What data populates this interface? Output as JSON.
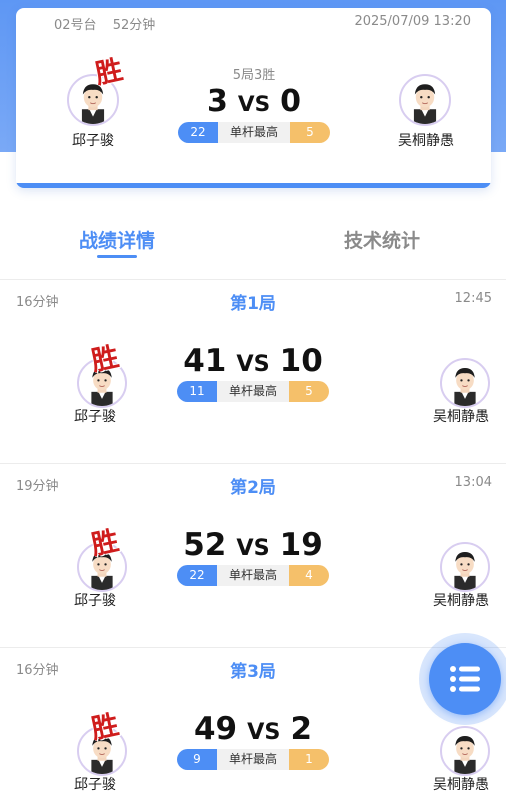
{
  "match": {
    "table": "02号台",
    "duration": "52分钟",
    "datetime": "2025/07/09 13:20",
    "format": "5局3胜",
    "player_a": {
      "name": "邱子骏",
      "score": "3",
      "high_break": "22"
    },
    "player_b": {
      "name": "吴桐静愚",
      "score": "0",
      "high_break": "5"
    },
    "vs": "VS",
    "high_break_label": "单杆最高",
    "win_badge": "胜"
  },
  "tabs": [
    {
      "label": "战绩详情",
      "active": true
    },
    {
      "label": "技术统计",
      "active": false
    }
  ],
  "games": [
    {
      "title": "第1局",
      "duration": "16分钟",
      "time": "12:45",
      "score_a": "41",
      "score_b": "10",
      "break_a": "11",
      "break_b": "5",
      "winner": "a"
    },
    {
      "title": "第2局",
      "duration": "19分钟",
      "time": "13:04",
      "score_a": "52",
      "score_b": "19",
      "break_a": "22",
      "break_b": "4",
      "winner": "a"
    },
    {
      "title": "第3局",
      "duration": "16分钟",
      "time": "",
      "score_a": "49",
      "score_b": "2",
      "break_a": "9",
      "break_b": "1",
      "winner": "a"
    }
  ],
  "fab": {
    "icon": "list-icon"
  },
  "colors": {
    "accent": "#4d8ef5",
    "secondary": "#f5c06a",
    "win": "#cf1c1c"
  }
}
